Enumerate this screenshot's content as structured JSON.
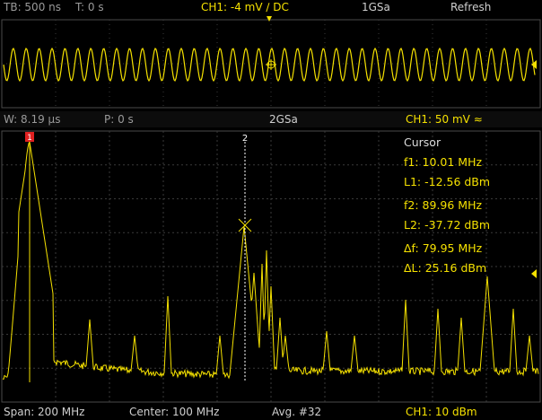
{
  "top_bar": {
    "timebase": "TB: 500 ns",
    "trigger_time": "T: 0 s",
    "channel_setting": "CH1: -4 mV ∕ DC",
    "sample_rate": "1GSa",
    "acq_mode": "Refresh"
  },
  "zoom_bar": {
    "window": "W: 8.19 µs",
    "position": "P: 0 s",
    "sample_rate": "2GSa",
    "channel_scale": "CH1: 50 mV ≈"
  },
  "cursor_panel": {
    "title": "Cursor",
    "f1": "f1: 10.01 MHz",
    "l1": "L1: -12.56 dBm",
    "f2": "f2: 89.96 MHz",
    "l2": "L2: -37.72 dBm",
    "delta_f": "Δf: 79.95 MHz",
    "delta_l": "ΔL: 25.16 dBm"
  },
  "cursor_markers": {
    "m1": "1",
    "m2": "2"
  },
  "bottom_bar": {
    "span": "Span: 200 MHz",
    "center": "Center: 100 MHz",
    "avg": "Avg. #32",
    "channel_ref": "CH1: 10 dBm"
  },
  "colors": {
    "trace": "#f5e100",
    "grid": "#3a3a3a",
    "cursor_marker": "#e02020"
  }
}
